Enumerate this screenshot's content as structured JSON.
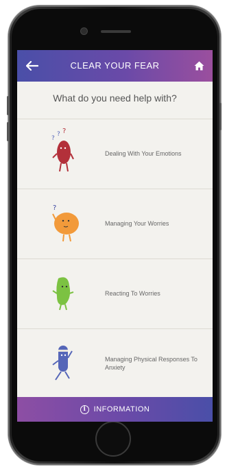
{
  "header": {
    "title": "CLEAR YOUR FEAR",
    "back_icon": "arrow-left-icon",
    "home_icon": "home-icon"
  },
  "question": "What do you need help with?",
  "items": [
    {
      "label": "Dealing With Your Emotions",
      "character": "red-character-question-marks",
      "color": "#b3303a"
    },
    {
      "label": "Managing Your Worries",
      "character": "orange-character-thinking",
      "color": "#f29a3a"
    },
    {
      "label": "Reacting To Worries",
      "character": "green-character-bean",
      "color": "#7cc242"
    },
    {
      "label": "Managing Physical Responses To Anxiety",
      "character": "blue-character-running",
      "color": "#5566b8"
    }
  ],
  "footer": {
    "label": "INFORMATION",
    "icon": "info-icon"
  },
  "colors": {
    "header_start": "#4a4fa8",
    "header_end": "#9b4f9e",
    "background": "#f3f2ee"
  }
}
